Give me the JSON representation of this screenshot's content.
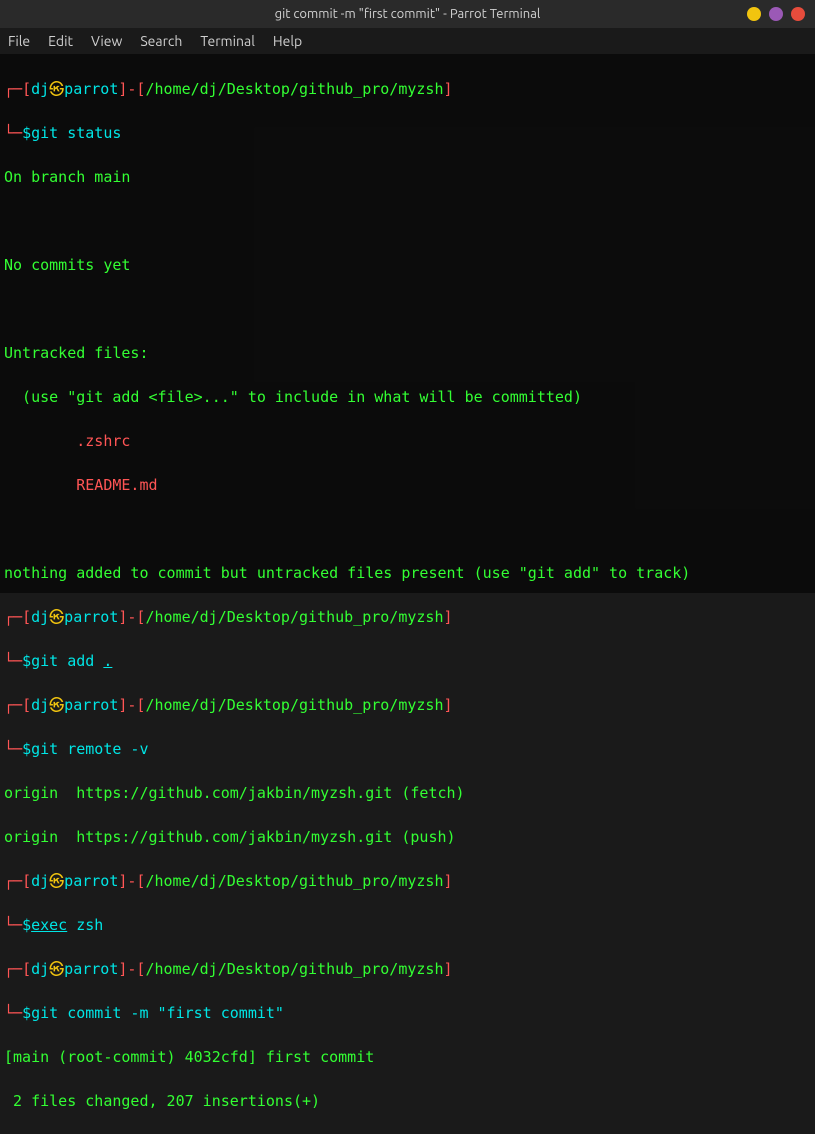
{
  "titlebar": {
    "title": "git commit -m \"first commit\" - Parrot Terminal"
  },
  "menubar": {
    "items": [
      "File",
      "Edit",
      "View",
      "Search",
      "Terminal",
      "Help"
    ]
  },
  "prompt": {
    "user": "dj",
    "symbol": "㉿",
    "host": "parrot",
    "path": "/home/dj/Desktop/github_pro/myzsh",
    "open_bracket": "[",
    "close_bracket": "]",
    "dash": "-",
    "corner_top": "┌─",
    "corner_bot": "└─",
    "dollar": "$"
  },
  "cmds": {
    "git_status": "git status",
    "git_add": "git add ",
    "git_add_dot": ".",
    "git_remote": "git remote -v",
    "exec_zsh": " zsh",
    "exec_label": "exec",
    "git_commit": "git commit -m \"first commit\""
  },
  "out": {
    "branch": "On branch main",
    "no_commits": "No commits yet",
    "untracked_hdr": "Untracked files:",
    "untracked_hint": "  (use \"git add <file>...\" to include in what will be committed)",
    "file1": "        .zshrc",
    "file2": "        README.md",
    "nothing_added": "nothing added to commit but untracked files present (use \"git add\" to track)",
    "remote_fetch": "origin  https://github.com/jakbin/myzsh.git (fetch)",
    "remote_push": "origin  https://github.com/jakbin/myzsh.git (push)",
    "commit_result": "[main (root-commit) 4032cfd] first commit",
    "commit_stats": " 2 files changed, 207 insertions(+)"
  }
}
